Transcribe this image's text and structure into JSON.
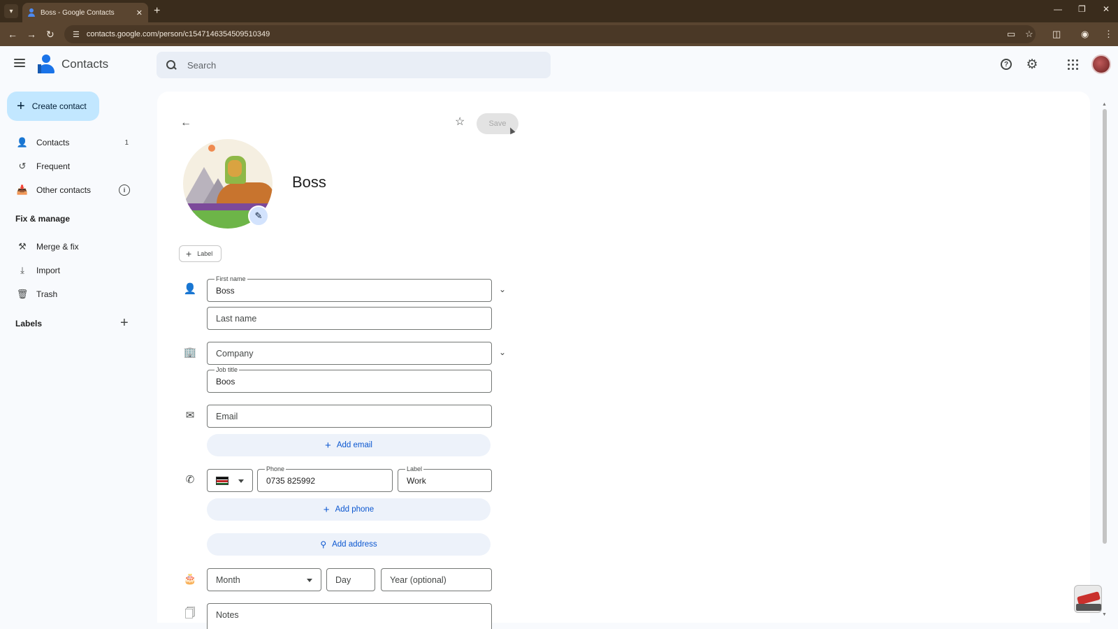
{
  "browser": {
    "tab_title": "Boss - Google Contacts",
    "url": "contacts.google.com/person/c1547146354509510349"
  },
  "header": {
    "app_name": "Contacts",
    "search_placeholder": "Search"
  },
  "sidebar": {
    "create_label": "Create contact",
    "items": [
      {
        "label": "Contacts",
        "count": "1",
        "icon": "person-icon"
      },
      {
        "label": "Frequent",
        "icon": "history-icon"
      },
      {
        "label": "Other contacts",
        "icon": "inbox-download-icon"
      }
    ],
    "fix_manage_title": "Fix & manage",
    "fix_items": [
      {
        "label": "Merge & fix",
        "icon": "tools-icon"
      },
      {
        "label": "Import",
        "icon": "download-icon"
      },
      {
        "label": "Trash",
        "icon": "trash-icon"
      }
    ],
    "labels_title": "Labels"
  },
  "editor": {
    "save_label": "Save",
    "contact_name": "Boss",
    "label_chip": "Label",
    "first_name_label": "First name",
    "first_name_value": "Boss",
    "last_name_placeholder": "Last name",
    "company_placeholder": "Company",
    "job_title_label": "Job title",
    "job_title_value": "Boos",
    "email_placeholder": "Email",
    "add_email": "Add email",
    "phone_label": "Phone",
    "phone_value": "0735 825992",
    "phone_type_label": "Label",
    "phone_type_value": "Work",
    "add_phone": "Add phone",
    "add_address": "Add address",
    "month_placeholder": "Month",
    "day_placeholder": "Day",
    "year_placeholder": "Year (optional)",
    "notes_placeholder": "Notes"
  },
  "colors": {
    "accent": "#0b57d0",
    "create_button_bg": "#c2e7ff",
    "pill_bg": "#edf2fa"
  }
}
